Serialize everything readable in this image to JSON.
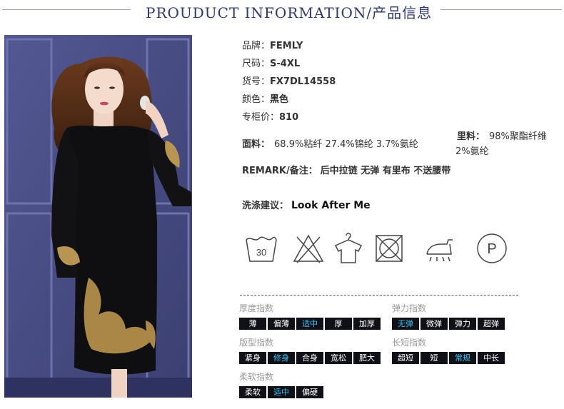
{
  "header": {
    "title": "PROUDUCT INFORMATION/产品信息"
  },
  "specs": {
    "brand_label": "品牌：",
    "brand_value": "FEMLY",
    "size_label": "尺码：",
    "size_value": "S-4XL",
    "sku_label": "货号：",
    "sku_value": "FX7DL14558",
    "color_label": "颜色：",
    "color_value": "黑色",
    "price_label": "专柜价：",
    "price_value": "810",
    "fabric_label": "面料：",
    "fabric_value": "68.9%粘纤 27.4%锦纶 3.7%氨纶",
    "lining_label": "里料：",
    "lining_value_1": "98%聚酯纤维",
    "lining_value_2": "2%氨纶",
    "remark_label": "REMARK/备注：",
    "remark_value": "后中拉链 无弹 有里布 不送腰带",
    "wash_label": "洗涤建议：",
    "wash_value": "Look After Me"
  },
  "care_icons": {
    "wash_temp": "30",
    "dry_clean_letter": "P",
    "icons": [
      "wash-30-icon",
      "no-bleach-icon",
      "hang-dry-icon",
      "no-tumble-dry-icon",
      "iron-steam-icon",
      "dry-clean-p-icon"
    ]
  },
  "indices": {
    "thickness": {
      "label": "厚度指数",
      "options": [
        "薄",
        "偏薄",
        "适中",
        "厚",
        "加厚"
      ],
      "selected": "适中"
    },
    "elasticity": {
      "label": "弹力指数",
      "options": [
        "无弹",
        "微弹",
        "弹力",
        "超弹"
      ],
      "selected": "无弹"
    },
    "fit": {
      "label": "版型指数",
      "options": [
        "紧身",
        "修身",
        "合身",
        "宽松",
        "肥大"
      ],
      "selected": "修身"
    },
    "length": {
      "label": "长短指数",
      "options": [
        "超短",
        "短",
        "常规",
        "中长"
      ],
      "selected": "常规"
    },
    "softness": {
      "label": "柔软指数",
      "options": [
        "柔软",
        "适中",
        "偏硬"
      ],
      "selected": "适中"
    }
  },
  "colors": {
    "accent": "#35c6f4",
    "cell_bg": "#101018",
    "title": "#2d3a6e",
    "wall": "#4a4f86"
  }
}
